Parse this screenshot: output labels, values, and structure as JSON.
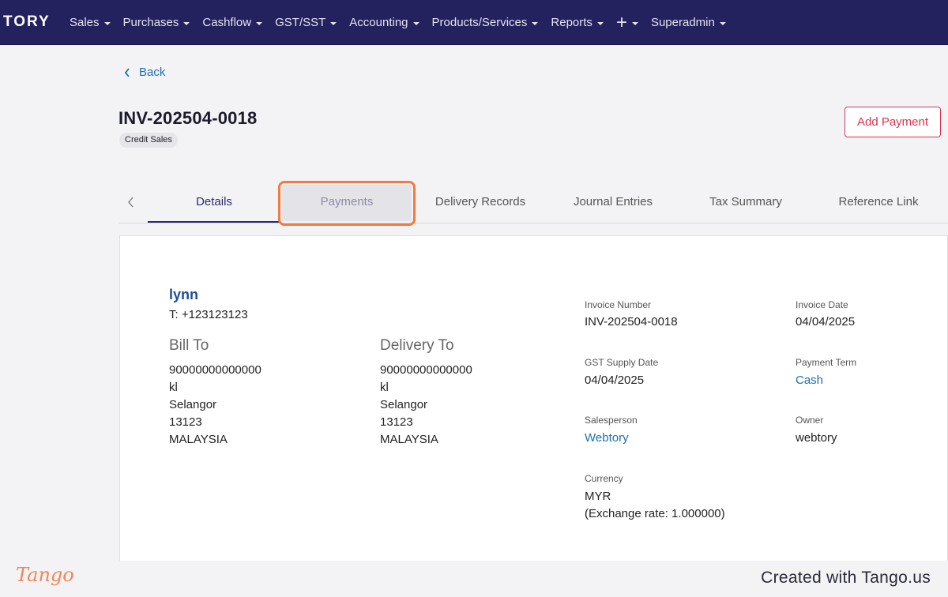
{
  "topbar": {
    "brand": "TORY",
    "nav": [
      {
        "label": "Sales",
        "icon": "caret-down-icon"
      },
      {
        "label": "Purchases",
        "icon": "caret-down-icon"
      },
      {
        "label": "Cashflow",
        "icon": "caret-down-icon"
      },
      {
        "label": "GST/SST",
        "icon": "caret-down-icon"
      },
      {
        "label": "Accounting",
        "icon": "caret-down-icon"
      },
      {
        "label": "Products/Services",
        "icon": "caret-down-icon"
      },
      {
        "label": "Reports",
        "icon": "caret-down-icon"
      },
      {
        "label": "+",
        "icon": "plus-icon"
      },
      {
        "label": "Superadmin",
        "icon": "caret-down-icon"
      }
    ]
  },
  "page": {
    "back_label": "Back",
    "invoice_title": "INV-202504-0018",
    "badge": "Credit Sales",
    "add_payment_label": "Add Payment"
  },
  "tabs": [
    {
      "label": "Details",
      "state": "active"
    },
    {
      "label": "Payments",
      "state": "highlighted"
    },
    {
      "label": "Delivery Records",
      "state": "normal"
    },
    {
      "label": "Journal Entries",
      "state": "normal"
    },
    {
      "label": "Tax Summary",
      "state": "normal"
    },
    {
      "label": "Reference Link",
      "state": "normal"
    }
  ],
  "customer": {
    "name": "lynn",
    "phone": "T: +123123123"
  },
  "bill_to": {
    "title": "Bill To",
    "lines": [
      "90000000000000",
      "kl",
      "Selangor",
      "13123",
      "MALAYSIA"
    ]
  },
  "delivery_to": {
    "title": "Delivery To",
    "lines": [
      "90000000000000",
      "kl",
      "Selangor",
      "13123",
      "MALAYSIA"
    ]
  },
  "meta": {
    "invoice_number": {
      "label": "Invoice Number",
      "value": "INV-202504-0018"
    },
    "invoice_date": {
      "label": "Invoice Date",
      "value": "04/04/2025"
    },
    "gst_supply_date": {
      "label": "GST Supply Date",
      "value": "04/04/2025"
    },
    "payment_term": {
      "label": "Payment Term",
      "value": "Cash"
    },
    "salesperson": {
      "label": "Salesperson",
      "value": "Webtory"
    },
    "owner": {
      "label": "Owner",
      "value": "webtory"
    },
    "currency": {
      "label": "Currency",
      "value": "MYR",
      "rate": "(Exchange rate: 1.000000)"
    }
  },
  "footer": {
    "logo": "Tango",
    "credit": "Created with Tango.us"
  },
  "colors": {
    "topbar": "#23215e",
    "accent_red": "#d9344f",
    "link_blue": "#1e6fb0",
    "focus_orange": "#f47b3d"
  }
}
